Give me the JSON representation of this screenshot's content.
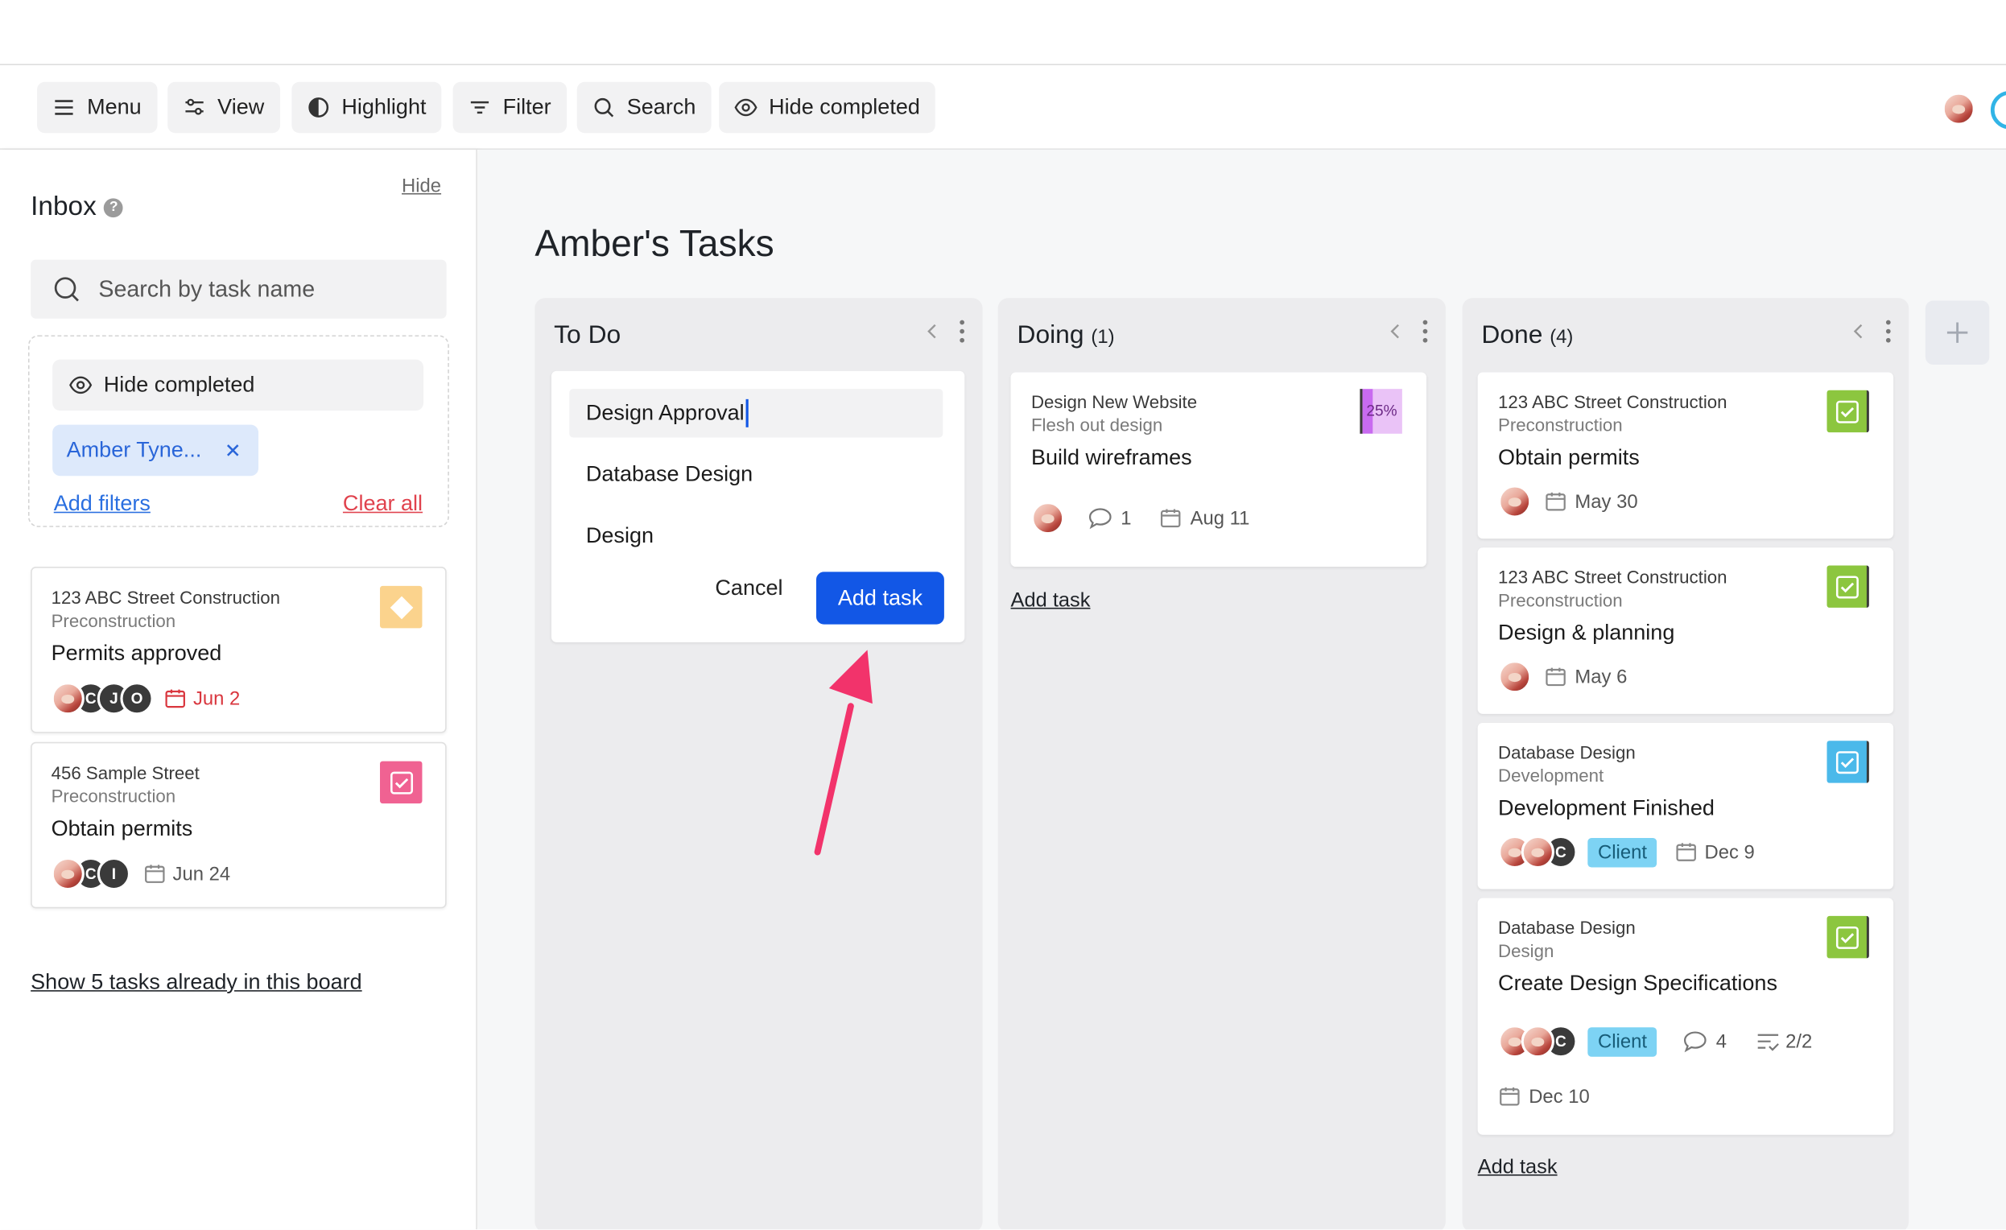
{
  "toolbar": {
    "menu": "Menu",
    "view": "View",
    "highlight": "Highlight",
    "filter": "Filter",
    "search": "Search",
    "hide_completed": "Hide completed"
  },
  "inbox": {
    "title": "Inbox",
    "help": "?",
    "hide": "Hide",
    "search_placeholder": "Search by task name",
    "hide_completed": "Hide completed",
    "filter_chip": "Amber Tyne...",
    "add_filters": "Add filters",
    "clear_all": "Clear all",
    "cards": [
      {
        "project": "123 ABC Street Construction",
        "phase": "Preconstruction",
        "title": "Permits approved",
        "avatars": [
          "C",
          "J",
          "O"
        ],
        "date": "Jun 2"
      },
      {
        "project": "456 Sample Street",
        "phase": "Preconstruction",
        "title": "Obtain permits",
        "avatars": [
          "C",
          "I"
        ],
        "date": "Jun 24"
      }
    ],
    "show_tasks": "Show 5 tasks already in this board"
  },
  "board": {
    "title": "Amber's Tasks",
    "columns": [
      {
        "name": "To Do",
        "count": "",
        "new_task_input": "Design Approval",
        "suggestions": [
          "Database Design",
          "Design"
        ],
        "cancel": "Cancel",
        "add": "Add task"
      },
      {
        "name": "Doing",
        "count": "(1)",
        "cards": [
          {
            "project": "Design New Website",
            "phase": "Flesh out design",
            "title": "Build wireframes",
            "progress": "25%",
            "comments": "1",
            "date": "Aug 11"
          }
        ],
        "add_task": "Add task"
      },
      {
        "name": "Done",
        "count": "(4)",
        "cards": [
          {
            "project": "123 ABC Street Construction",
            "phase": "Preconstruction",
            "title": "Obtain permits",
            "date": "May 30"
          },
          {
            "project": "123 ABC Street Construction",
            "phase": "Preconstruction",
            "title": "Design & planning",
            "date": "May 6"
          },
          {
            "project": "Database Design",
            "phase": "Development",
            "title": "Development Finished",
            "avatar_letter": "C",
            "tag": "Client",
            "date": "Dec 9"
          },
          {
            "project": "Database Design",
            "phase": "Design",
            "title": "Create Design Specifications",
            "avatar_letter": "C",
            "tag": "Client",
            "comments": "4",
            "checklist": "2/2",
            "date": "Dec 10"
          }
        ],
        "add_task": "Add task"
      }
    ]
  },
  "colors": {
    "primary_button": "#1257e6",
    "link_blue": "#2a6fe0",
    "clear_red": "#e0424d",
    "overdue_red": "#d9363e",
    "status_green": "#8cc63f",
    "status_blue": "#4bb9ea",
    "status_pink": "#f06292",
    "status_yellow": "#fbd38d",
    "progress_purple": "#c86bf0",
    "annotation_arrow": "#f2336b",
    "tag_client": "#7dd3f4"
  },
  "icons": [
    "menu-icon",
    "sliders-icon",
    "contrast-icon",
    "filter-icon",
    "search-icon",
    "eye-icon",
    "help-icon",
    "close-icon",
    "calendar-icon",
    "comment-icon",
    "checklist-icon",
    "chevron-left-icon",
    "kebab-icon",
    "plus-icon",
    "checkbox-icon",
    "diamond-icon"
  ]
}
